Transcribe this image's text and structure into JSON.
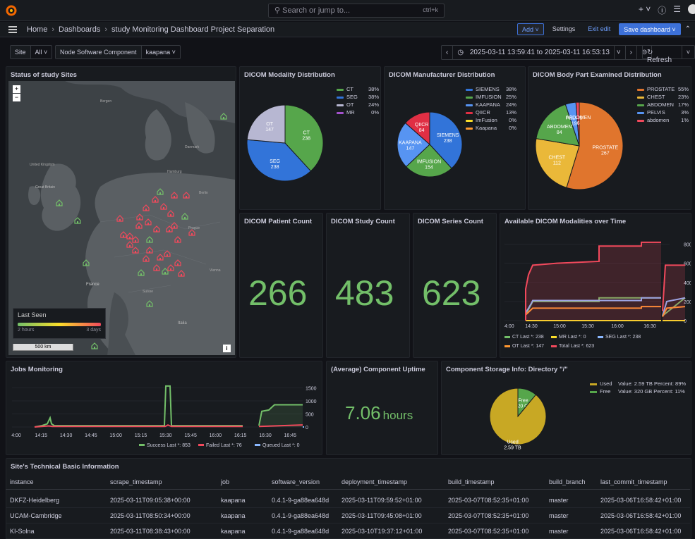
{
  "header": {
    "search_placeholder": "Search or jump to...",
    "search_shortcut": "ctrl+k",
    "add_label": "Add",
    "settings_label": "Settings",
    "exit_edit_label": "Exit edit",
    "save_label": "Save dashboard"
  },
  "breadcrumb": {
    "home": "Home",
    "dashboards": "Dashboards",
    "current": "study Monitoring Dashboard Project Separation"
  },
  "variables": [
    {
      "label": "Site",
      "value": "All"
    },
    {
      "label": "Node Software Component",
      "value": "kaapana"
    }
  ],
  "time_range": "2025-03-11 13:59:41 to 2025-03-11 16:53:13",
  "refresh_label": "Refresh",
  "panels": {
    "map_title": "Status of study Sites",
    "map_legend_title": "Last Seen",
    "map_legend_min": "2 hours",
    "map_legend_max": "3 days",
    "map_scale": "500 km",
    "map_zoom_in": "+",
    "map_zoom_out": "−",
    "map_place_labels": [
      "Bergen",
      "Hamburg",
      "Great Britain",
      "United Kingdom",
      "France",
      "Berlin",
      "Prague",
      "Vienna",
      "Suisse",
      "Italia",
      "Danmark"
    ],
    "modality_title": "DICOM Modality Distribution",
    "manufacturer_title": "DICOM Manufacturer Distribution",
    "bodypart_title": "DICOM Body Part Examined Distribution",
    "patient_title": "DICOM Patient Count",
    "study_title": "DICOM Study Count",
    "series_title": "DICOM Series Count",
    "patient_value": "266",
    "study_value": "483",
    "series_value": "623",
    "modalities_time_title": "Available DICOM Modalities over Time",
    "jobs_title": "Jobs Monitoring",
    "uptime_title": "(Average) Component Uptime",
    "uptime_value": "7.06",
    "uptime_unit": "hours",
    "storage_title": "Component Storage Info: Directory \"/\"",
    "table_title": "Site's Technical Basic Information"
  },
  "chart_data": [
    {
      "type": "pie",
      "title": "DICOM Modality Distribution",
      "categories": [
        "CT",
        "SEG",
        "OT",
        "MR"
      ],
      "values": [
        238,
        238,
        147,
        0
      ],
      "percents": [
        "38%",
        "38%",
        "24%",
        "0%"
      ],
      "colors": [
        "#56a64b",
        "#3274d9",
        "#b7b7d2",
        "#a352cc"
      ],
      "slice_labels": [
        "CT\n238",
        "SEG\n238",
        "OT\n147",
        ""
      ]
    },
    {
      "type": "pie",
      "title": "DICOM Manufacturer Distribution",
      "categories": [
        "SIEMENS",
        "IMFUSION",
        "KAAPANA",
        "QIICR",
        "ImFusion",
        "Kaapana"
      ],
      "values": [
        238,
        154,
        147,
        84,
        0,
        0
      ],
      "percents": [
        "38%",
        "25%",
        "24%",
        "13%",
        "0%",
        "0%"
      ],
      "colors": [
        "#3274d9",
        "#56a64b",
        "#5794f2",
        "#e02f44",
        "#fade2a",
        "#ff9830"
      ]
    },
    {
      "type": "pie",
      "title": "DICOM Body Part Examined Distribution",
      "categories": [
        "PROSTATE",
        "CHEST",
        "ABDOMEN",
        "PELVIS",
        "abdomen"
      ],
      "values": [
        267,
        112,
        84,
        19,
        6
      ],
      "percents": [
        "55%",
        "23%",
        "17%",
        "3%",
        "1%"
      ],
      "colors": [
        "#e0752d",
        "#eab839",
        "#56a64b",
        "#5794f2",
        "#f2495c"
      ]
    },
    {
      "type": "line",
      "title": "Available DICOM Modalities over Time",
      "x_ticks": [
        "4:00",
        "14:30",
        "15:00",
        "15:30",
        "16:00",
        "16:30"
      ],
      "y_ticks": [
        "0",
        "200",
        "400",
        "600",
        "800"
      ],
      "ylim": [
        0,
        900
      ],
      "series": [
        {
          "name": "CT",
          "last": "Last *: 238",
          "color": "#73bf69"
        },
        {
          "name": "MR",
          "last": "Last *: 0",
          "color": "#fade2a"
        },
        {
          "name": "SEG",
          "last": "Last *: 238",
          "color": "#8ab8ff"
        },
        {
          "name": "OT",
          "last": "Last *: 147",
          "color": "#ff9830"
        },
        {
          "name": "Total",
          "last": "Last *: 623",
          "color": "#f2495c"
        }
      ]
    },
    {
      "type": "line",
      "title": "Jobs Monitoring",
      "x_ticks": [
        "4:00",
        "14:15",
        "14:30",
        "14:45",
        "15:00",
        "15:15",
        "15:30",
        "15:45",
        "16:00",
        "16:15",
        "16:30",
        "16:45"
      ],
      "y_ticks": [
        "0",
        "500",
        "1000",
        "1500"
      ],
      "ylim": [
        0,
        1700
      ],
      "series": [
        {
          "name": "Success",
          "last": "Last *: 853",
          "color": "#73bf69"
        },
        {
          "name": "Failed",
          "last": "Last *: 76",
          "color": "#f2495c"
        },
        {
          "name": "Queued",
          "last": "Last *: 0",
          "color": "#8ab8ff"
        }
      ]
    },
    {
      "type": "pie",
      "title": "Component Storage Info: Directory \"/\"",
      "categories": [
        "Used",
        "Free"
      ],
      "values": [
        2.59,
        0.32
      ],
      "legend": [
        "Value: 2.59 TB  Percent: 89%",
        "Value: 320 GB  Percent: 11%"
      ],
      "colors": [
        "#c8a824",
        "#56a64b"
      ],
      "slice_labels": [
        "Used\n2.59 TB",
        "Free\n320 GB"
      ]
    }
  ],
  "table": {
    "columns": [
      "instance",
      "scrape_timestamp",
      "job",
      "software_version",
      "deployment_timestamp",
      "build_timestamp",
      "build_branch",
      "last_commit_timestamp"
    ],
    "rows": [
      [
        "DKFZ-Heidelberg",
        "2025-03-11T09:05:38+00:00",
        "kaapana",
        "0.4.1-9-ga88ea648d",
        "2025-03-11T09:59:52+01:00",
        "2025-03-07T08:52:35+01:00",
        "master",
        "2025-03-06T16:58:42+01:00"
      ],
      [
        "UCAM-Cambridge",
        "2025-03-11T08:50:34+00:00",
        "kaapana",
        "0.4.1-9-ga88ea648d",
        "2025-03-11T09:45:08+01:00",
        "2025-03-07T08:52:35+01:00",
        "master",
        "2025-03-06T16:58:42+01:00"
      ],
      [
        "KI-Solna",
        "2025-03-11T08:38:43+00:00",
        "kaapana",
        "0.4.1-9-ga88ea648d",
        "2025-03-10T19:37:12+01:00",
        "2025-03-07T08:52:35+01:00",
        "master",
        "2025-03-06T16:58:42+01:00"
      ]
    ]
  }
}
